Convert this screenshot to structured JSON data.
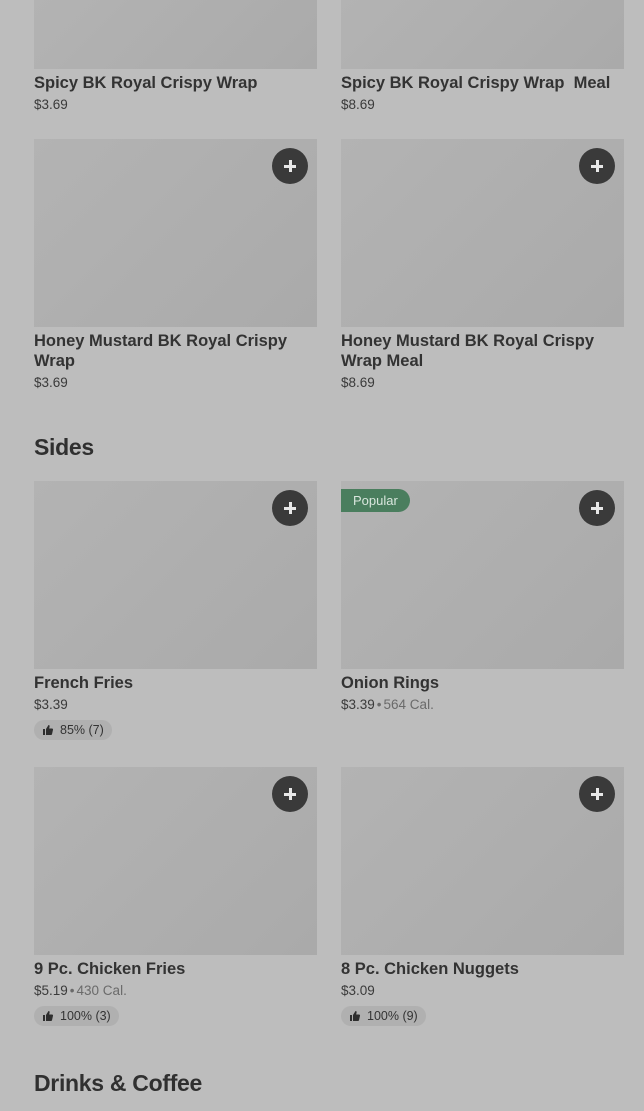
{
  "row1": [
    {
      "name": "Spicy BK Royal Crispy Wrap",
      "price": "$3.69"
    },
    {
      "name": "Spicy BK Royal Crispy Wrap  Meal",
      "price": "$8.69"
    }
  ],
  "row2": [
    {
      "name": "Honey Mustard BK Royal Crispy Wrap",
      "price": "$3.69"
    },
    {
      "name": "Honey Mustard BK Royal Crispy Wrap Meal",
      "price": "$8.69"
    }
  ],
  "sections": {
    "sides": "Sides",
    "drinks": "Drinks & Coffee"
  },
  "sides": [
    {
      "name": "French Fries",
      "price": "$3.39",
      "rating": "85% (7)"
    },
    {
      "name": "Onion Rings",
      "price": "$3.39",
      "calories": "564 Cal.",
      "badge": "Popular"
    },
    {
      "name": "9 Pc. Chicken Fries",
      "price": "$5.19",
      "calories": "430 Cal.",
      "rating": "100% (3)"
    },
    {
      "name": "8 Pc. Chicken Nuggets",
      "price": "$3.09",
      "rating": "100% (9)"
    }
  ],
  "separator": "•",
  "icons": {
    "add": "plus-icon",
    "rating": "thumbs-up-icon"
  }
}
